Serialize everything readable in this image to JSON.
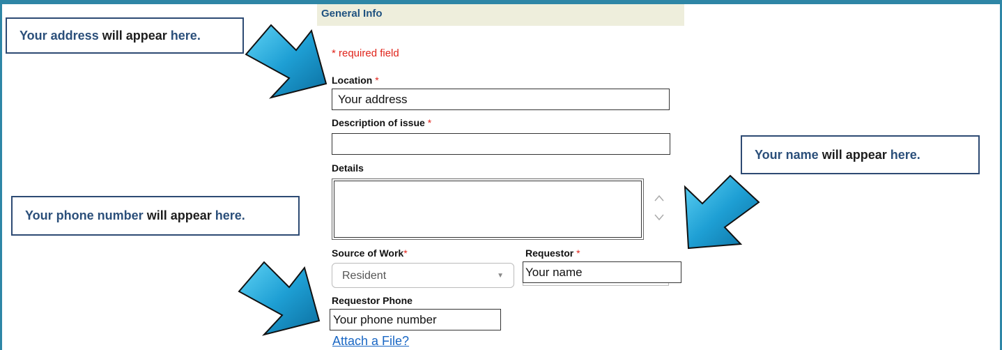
{
  "section": {
    "title": "General Info"
  },
  "required_note": "* required field",
  "star": "*",
  "location": {
    "label": "Location",
    "value": "Your address"
  },
  "description": {
    "label": "Description of issue",
    "value": ""
  },
  "details": {
    "label": "Details",
    "value": ""
  },
  "source_of_work": {
    "label": "Source of Work",
    "value": "Resident",
    "caret": "▼"
  },
  "requestor": {
    "label": "Requestor",
    "value": "Your name"
  },
  "requestor_phone": {
    "label": "Requestor Phone",
    "value": "Your phone number"
  },
  "attach_link": "Attach a File?",
  "callouts": {
    "address": {
      "highlight": "Your address",
      "mid": "will appear",
      "end": "here."
    },
    "name": {
      "highlight": "Your name",
      "mid": "will appear",
      "end": "here."
    },
    "phone": {
      "highlight": "Your phone number",
      "mid": "will appear",
      "end": "here."
    }
  },
  "colors": {
    "frame": "#2e86a6",
    "header_bg": "#eeeedc",
    "header_text": "#1f5280",
    "required": "#e0241b",
    "link": "#1a67c4",
    "callout_border": "#2d4a73",
    "arrow": "#1e9fd4"
  }
}
